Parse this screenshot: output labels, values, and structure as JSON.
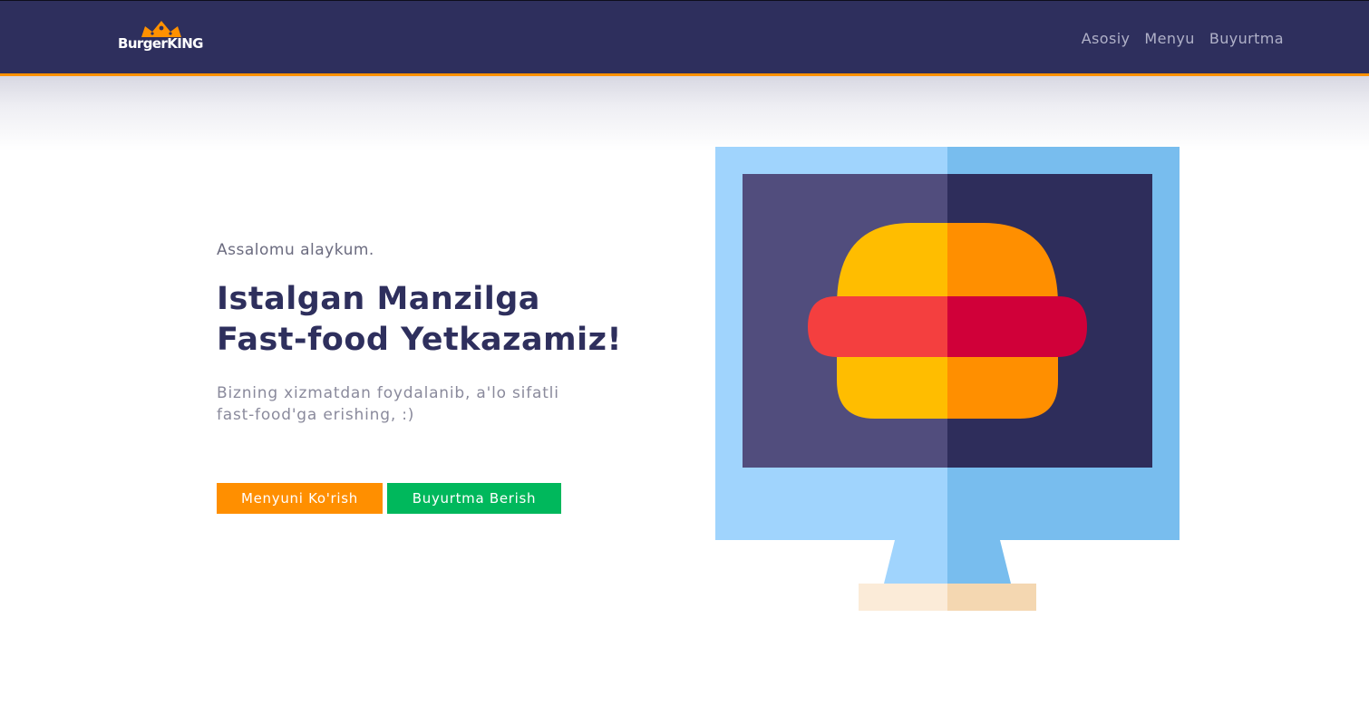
{
  "brand": {
    "logo_text": "BurgerKING",
    "logo_icon": "crown-icon"
  },
  "nav": {
    "links": [
      "Asosiy",
      "Menyu",
      "Buyurtma"
    ]
  },
  "hero": {
    "greeting": "Assalomu alaykum.",
    "headline_line1": "Istalgan Manzilga",
    "headline_line2": "Fast-food Yetkazamiz!",
    "subtext": "Bizning xizmatdan foydalanib, a'lo sifatli fast-food'ga erishing, :)",
    "primary_button": "Menyuni Ko'rish",
    "secondary_button": "Buyurtma Berish",
    "illustration_icon": "monitor-burger-icon"
  },
  "colors": {
    "navbar": "#2e2f5d",
    "accent_orange": "#ff8f00",
    "accent_green": "#00b85c",
    "headline": "#2e2f5d"
  }
}
